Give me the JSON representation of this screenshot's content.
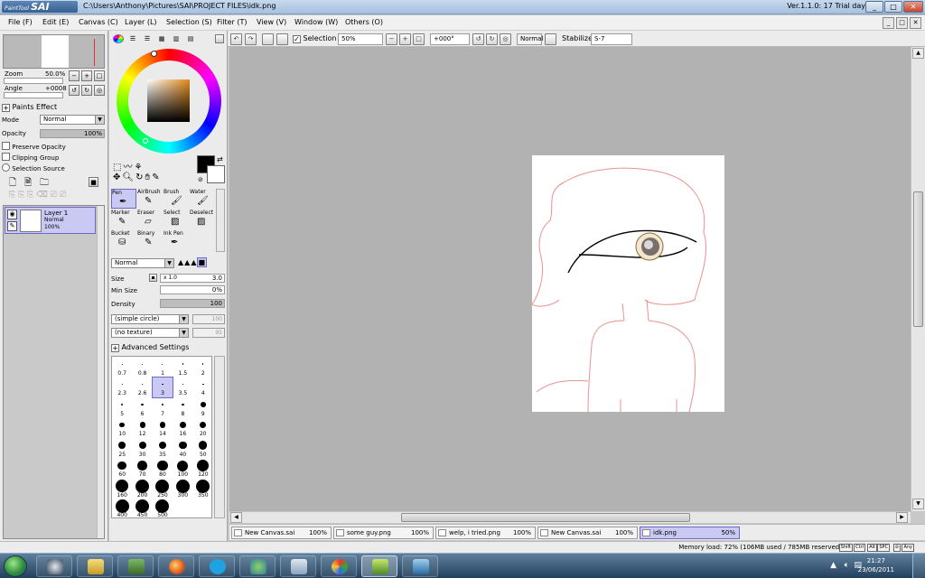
{
  "titlebar": {
    "logo_prefix": "PaintTool",
    "logo_name": "SAI",
    "path": "C:\\Users\\Anthony\\Pictures\\SAI\\PROJECT FILES\\idk.png",
    "version": "Ver.1.1.0: 17 Trial day",
    "minimize": "_",
    "maximize": "□",
    "close": "✕"
  },
  "menu": {
    "items": [
      "File (F)",
      "Edit (E)",
      "Canvas (C)",
      "Layer (L)",
      "Selection (S)",
      "Filter (T)",
      "View (V)",
      "Window (W)",
      "Others (O)"
    ]
  },
  "toolbar": {
    "selection_label": "Selection",
    "selection_checked": "✓",
    "zoom_value": "50%",
    "rotation_value": "+000°",
    "blend_value": "Normal",
    "stabilizer_label": "Stabilizer",
    "stabilizer_value": "S-7"
  },
  "navigator": {
    "zoom_label": "Zoom",
    "zoom_value": "50.0%",
    "angle_label": "Angle",
    "angle_value": "+0008"
  },
  "layer_props": {
    "paints_effect": "Paints Effect",
    "mode_label": "Mode",
    "mode_value": "Normal",
    "opacity_label": "Opacity",
    "opacity_value": "100%",
    "preserve_opacity": "Preserve Opacity",
    "clipping_group": "Clipping Group",
    "selection_source": "Selection Source"
  },
  "layers": [
    {
      "name": "Layer 1",
      "mode": "Normal",
      "opacity": "100%"
    }
  ],
  "tools": {
    "row1": [
      "Pen",
      "AirBrush",
      "Brush",
      "Water"
    ],
    "row2": [
      "Marker",
      "Eraser",
      "Select",
      "Deselect"
    ],
    "row3": [
      "Bucket",
      "Binary",
      "Ink Pen",
      ""
    ],
    "blend_mode": "Normal",
    "size_label": "Size",
    "size_multiplier": "x 1.0",
    "size_value": "3.0",
    "min_size_label": "Min Size",
    "min_size_value": "0%",
    "density_label": "Density",
    "density_value": "100",
    "shape_value": "(simple circle)",
    "shape_amount": "100",
    "texture_value": "(no texture)",
    "texture_amount": "95",
    "advanced_settings": "Advanced Settings"
  },
  "brush_sizes": [
    "0.7",
    "0.8",
    "1",
    "1.5",
    "2",
    "2.3",
    "2.6",
    "3",
    "3.5",
    "4",
    "5",
    "6",
    "7",
    "8",
    "9",
    "10",
    "12",
    "14",
    "16",
    "20",
    "25",
    "30",
    "35",
    "40",
    "50",
    "60",
    "70",
    "80",
    "100",
    "120",
    "160",
    "200",
    "250",
    "300",
    "350",
    "400",
    "450",
    "500"
  ],
  "documents": [
    {
      "name": "New Canvas.sai",
      "zoom": "100%"
    },
    {
      "name": "some guy.png",
      "zoom": "100%"
    },
    {
      "name": "welp, i tried.png",
      "zoom": "100%"
    },
    {
      "name": "New Canvas.sai",
      "zoom": "100%"
    },
    {
      "name": "idk.png",
      "zoom": "50%"
    }
  ],
  "status": {
    "memory": "Memory load: 72% (106MB used / 785MB reserved)",
    "keys": [
      "Shift",
      "Ctrl",
      "Alt",
      "SPC",
      "⊘",
      "Any"
    ]
  },
  "taskbar": {
    "time": "21:27",
    "date": "23/06/2011"
  },
  "colors": {
    "accent_selection": "#c9c9f4",
    "sketch_line": "#e8938f"
  }
}
